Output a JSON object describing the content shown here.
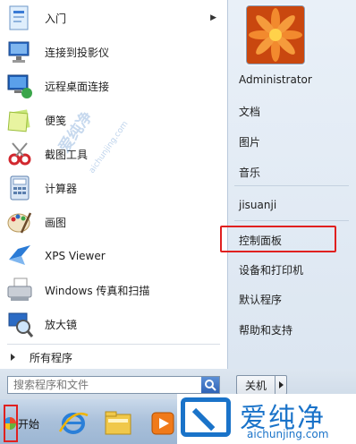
{
  "programs": [
    {
      "label": "入门",
      "icon": "getting-started-icon",
      "has_submenu": true
    },
    {
      "label": "连接到投影仪",
      "icon": "projector-icon",
      "has_submenu": false
    },
    {
      "label": "远程桌面连接",
      "icon": "remote-desktop-icon",
      "has_submenu": false
    },
    {
      "label": "便笺",
      "icon": "sticky-notes-icon",
      "has_submenu": false
    },
    {
      "label": "截图工具",
      "icon": "snipping-tool-icon",
      "has_submenu": false
    },
    {
      "label": "计算器",
      "icon": "calculator-icon",
      "has_submenu": false
    },
    {
      "label": "画图",
      "icon": "paint-icon",
      "has_submenu": false
    },
    {
      "label": "XPS Viewer",
      "icon": "xps-viewer-icon",
      "has_submenu": false
    },
    {
      "label": "Windows 传真和扫描",
      "icon": "fax-scan-icon",
      "has_submenu": false
    },
    {
      "label": "放大镜",
      "icon": "magnifier-icon",
      "has_submenu": false
    }
  ],
  "all_programs": "所有程序",
  "right_items": {
    "user": "Administrator",
    "documents": "文档",
    "pictures": "图片",
    "music": "音乐",
    "computer": "jisuanji",
    "control_panel": "控制面板",
    "devices": "设备和打印机",
    "default_programs": "默认程序",
    "help": "帮助和支持"
  },
  "search": {
    "placeholder": "搜索程序和文件"
  },
  "shutdown_label": "关机",
  "start_label": "开始",
  "taskbar_icons": [
    "internet-explorer-icon",
    "file-explorer-icon",
    "media-player-icon"
  ],
  "watermark": {
    "brand": "爱纯净",
    "url": "aichunjing.com"
  },
  "colors": {
    "highlight": "#e0201f",
    "brand_blue": "#1a73c9"
  }
}
